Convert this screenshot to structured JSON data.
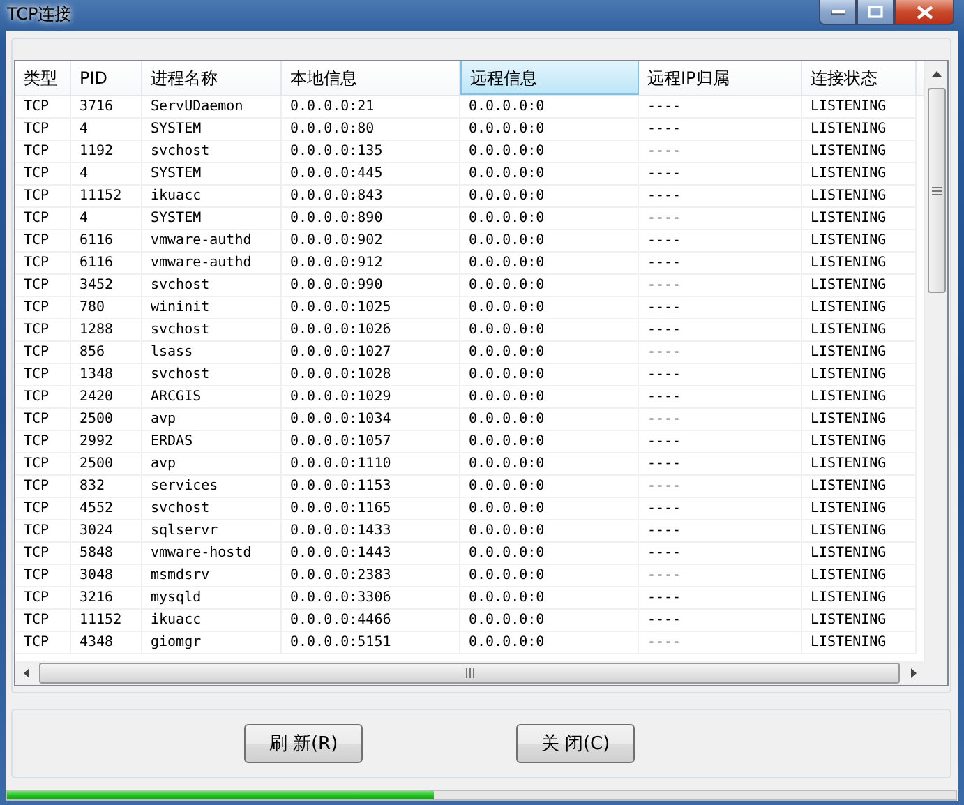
{
  "window": {
    "title": "TCP连接"
  },
  "table": {
    "columns": [
      {
        "label": "类型",
        "selected": false
      },
      {
        "label": "PID",
        "selected": false
      },
      {
        "label": "进程名称",
        "selected": false
      },
      {
        "label": "本地信息",
        "selected": false
      },
      {
        "label": "远程信息",
        "selected": true
      },
      {
        "label": "远程IP归属",
        "selected": false
      },
      {
        "label": "连接状态",
        "selected": false
      }
    ],
    "rows": [
      [
        "TCP",
        "3716",
        "ServUDaemon",
        "0.0.0.0:21",
        "0.0.0.0:0",
        "----",
        "LISTENING"
      ],
      [
        "TCP",
        "4",
        "SYSTEM",
        "0.0.0.0:80",
        "0.0.0.0:0",
        "----",
        "LISTENING"
      ],
      [
        "TCP",
        "1192",
        "svchost",
        "0.0.0.0:135",
        "0.0.0.0:0",
        "----",
        "LISTENING"
      ],
      [
        "TCP",
        "4",
        "SYSTEM",
        "0.0.0.0:445",
        "0.0.0.0:0",
        "----",
        "LISTENING"
      ],
      [
        "TCP",
        "11152",
        "ikuacc",
        "0.0.0.0:843",
        "0.0.0.0:0",
        "----",
        "LISTENING"
      ],
      [
        "TCP",
        "4",
        "SYSTEM",
        "0.0.0.0:890",
        "0.0.0.0:0",
        "----",
        "LISTENING"
      ],
      [
        "TCP",
        "6116",
        "vmware-authd",
        "0.0.0.0:902",
        "0.0.0.0:0",
        "----",
        "LISTENING"
      ],
      [
        "TCP",
        "6116",
        "vmware-authd",
        "0.0.0.0:912",
        "0.0.0.0:0",
        "----",
        "LISTENING"
      ],
      [
        "TCP",
        "3452",
        "svchost",
        "0.0.0.0:990",
        "0.0.0.0:0",
        "----",
        "LISTENING"
      ],
      [
        "TCP",
        "780",
        "wininit",
        "0.0.0.0:1025",
        "0.0.0.0:0",
        "----",
        "LISTENING"
      ],
      [
        "TCP",
        "1288",
        "svchost",
        "0.0.0.0:1026",
        "0.0.0.0:0",
        "----",
        "LISTENING"
      ],
      [
        "TCP",
        "856",
        "lsass",
        "0.0.0.0:1027",
        "0.0.0.0:0",
        "----",
        "LISTENING"
      ],
      [
        "TCP",
        "1348",
        "svchost",
        "0.0.0.0:1028",
        "0.0.0.0:0",
        "----",
        "LISTENING"
      ],
      [
        "TCP",
        "2420",
        "ARCGIS",
        "0.0.0.0:1029",
        "0.0.0.0:0",
        "----",
        "LISTENING"
      ],
      [
        "TCP",
        "2500",
        "avp",
        "0.0.0.0:1034",
        "0.0.0.0:0",
        "----",
        "LISTENING"
      ],
      [
        "TCP",
        "2992",
        "ERDAS",
        "0.0.0.0:1057",
        "0.0.0.0:0",
        "----",
        "LISTENING"
      ],
      [
        "TCP",
        "2500",
        "avp",
        "0.0.0.0:1110",
        "0.0.0.0:0",
        "----",
        "LISTENING"
      ],
      [
        "TCP",
        "832",
        "services",
        "0.0.0.0:1153",
        "0.0.0.0:0",
        "----",
        "LISTENING"
      ],
      [
        "TCP",
        "4552",
        "svchost",
        "0.0.0.0:1165",
        "0.0.0.0:0",
        "----",
        "LISTENING"
      ],
      [
        "TCP",
        "3024",
        "sqlservr",
        "0.0.0.0:1433",
        "0.0.0.0:0",
        "----",
        "LISTENING"
      ],
      [
        "TCP",
        "5848",
        "vmware-hostd",
        "0.0.0.0:1443",
        "0.0.0.0:0",
        "----",
        "LISTENING"
      ],
      [
        "TCP",
        "3048",
        "msmdsrv",
        "0.0.0.0:2383",
        "0.0.0.0:0",
        "----",
        "LISTENING"
      ],
      [
        "TCP",
        "3216",
        "mysqld",
        "0.0.0.0:3306",
        "0.0.0.0:0",
        "----",
        "LISTENING"
      ],
      [
        "TCP",
        "11152",
        "ikuacc",
        "0.0.0.0:4466",
        "0.0.0.0:0",
        "----",
        "LISTENING"
      ],
      [
        "TCP",
        "4348",
        "giomgr",
        "0.0.0.0:5151",
        "0.0.0.0:0",
        "----",
        "LISTENING"
      ]
    ]
  },
  "buttons": [
    {
      "label": "刷 新(R)"
    },
    {
      "label": "关 闭(C)"
    }
  ],
  "progress": {
    "level": 0.45
  }
}
